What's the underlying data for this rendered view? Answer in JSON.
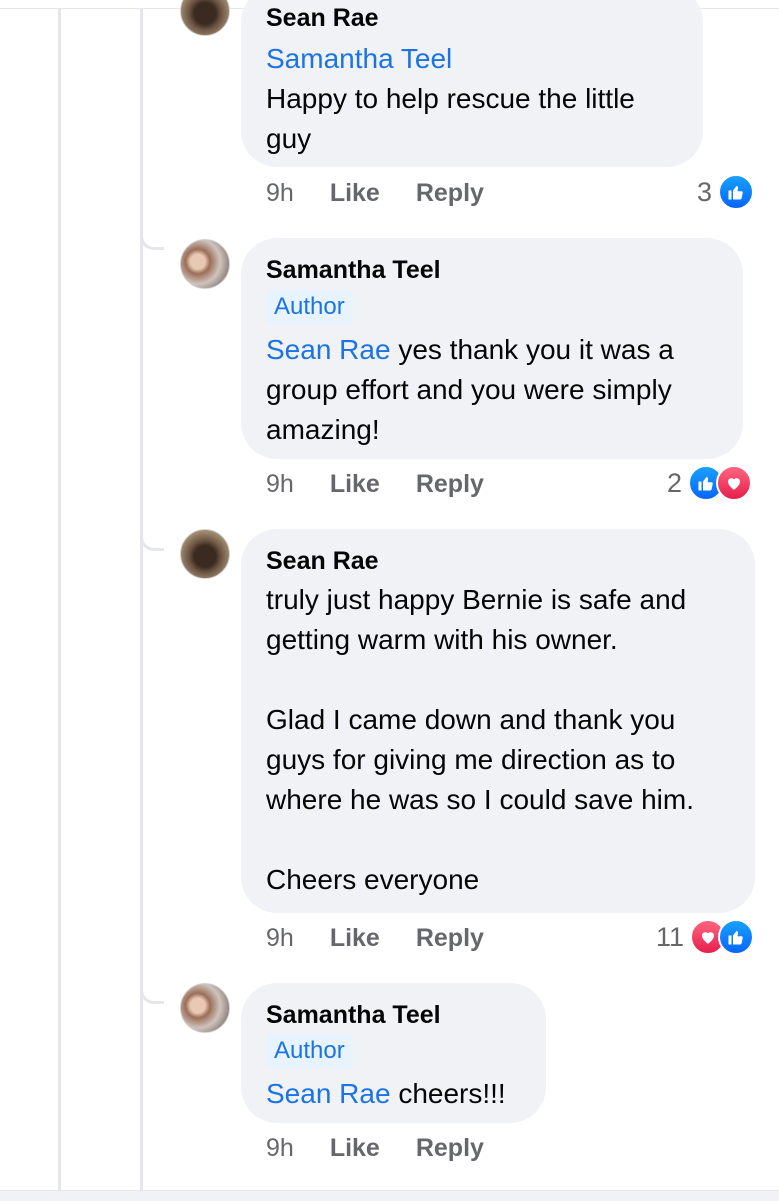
{
  "comments": [
    {
      "author": "Sean Rae",
      "mention": "Samantha Teel",
      "text": "Happy to help rescue the little\nguy",
      "time": "9h",
      "like": "Like",
      "reply": "Reply",
      "reaction_count": "3",
      "reactions": [
        "like"
      ]
    },
    {
      "author": "Samantha Teel",
      "badge": "Author",
      "mention": "Sean Rae",
      "text": " yes thank you it was a\ngroup effort and you were simply\namazing!",
      "time": "9h",
      "like": "Like",
      "reply": "Reply",
      "reaction_count": "2",
      "reactions": [
        "like",
        "love"
      ]
    },
    {
      "author": "Sean Rae",
      "text": "truly just happy Bernie is safe and\ngetting warm with his owner.\n\nGlad I came down and thank you\nguys for giving me direction as to\nwhere he was so I could save him.\n\nCheers everyone",
      "time": "9h",
      "like": "Like",
      "reply": "Reply",
      "reaction_count": "11",
      "reactions": [
        "love",
        "like"
      ]
    },
    {
      "author": "Samantha Teel",
      "badge": "Author",
      "mention": "Sean Rae",
      "text": " cheers!!!",
      "time": "9h",
      "like": "Like",
      "reply": "Reply"
    }
  ],
  "colors": {
    "bubble": "#f0f2f5",
    "mention": "#1b74e4",
    "meta": "#65676b",
    "like": "#0866ff",
    "love": "#e61e4d"
  }
}
